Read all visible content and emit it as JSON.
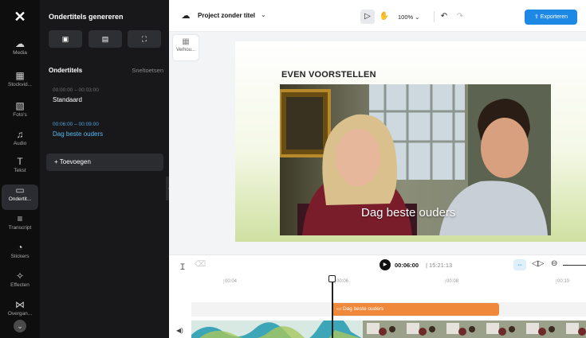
{
  "rail": {
    "items": [
      {
        "name": "media",
        "label": "Media",
        "icon": "media-icon",
        "glyph": "☁"
      },
      {
        "name": "stock",
        "label": "Stockvid...",
        "icon": "stock-video-icon",
        "glyph": "▦"
      },
      {
        "name": "photos",
        "label": "Foto's",
        "icon": "photo-icon",
        "glyph": "▧"
      },
      {
        "name": "audio",
        "label": "Audio",
        "icon": "music-note-icon",
        "glyph": "♫"
      },
      {
        "name": "text",
        "label": "Tekst",
        "icon": "text-icon",
        "glyph": "T"
      },
      {
        "name": "subtitles",
        "label": "Ondertit...",
        "icon": "subtitles-icon",
        "glyph": "▭"
      },
      {
        "name": "transcript",
        "label": "Transcript",
        "icon": "transcript-icon",
        "glyph": "≡"
      },
      {
        "name": "stickers",
        "label": "Stickers",
        "icon": "sticker-icon",
        "glyph": "◔"
      },
      {
        "name": "effects",
        "label": "Effecten",
        "icon": "effects-icon",
        "glyph": "✧"
      },
      {
        "name": "transitions",
        "label": "Overgan...",
        "icon": "transition-icon",
        "glyph": "⋈"
      }
    ],
    "active": "subtitles"
  },
  "panel": {
    "title": "Ondertitels genereren",
    "section_label": "Ondertitels",
    "shortcuts_label": "Sneltoetsen",
    "cues": [
      {
        "time": "00:00:00 – 00:03:00",
        "text": "Standaard",
        "selected": false
      },
      {
        "time": "00:06:00 – 00:09:00",
        "text": "Dag beste ouders",
        "selected": true
      }
    ],
    "add_label": "+ Toevoegen"
  },
  "topbar": {
    "project_title": "Project zonder titel",
    "zoom": "100%",
    "export_label": "⇪ Exporteren"
  },
  "stage": {
    "resize_label": "Verhou...",
    "heading": "EVEN VOORSTELLEN",
    "caption": "Dag beste ouders"
  },
  "timeline": {
    "current_time": "00:06:00",
    "total_time": "| 15:21:13",
    "ticks": [
      "00:04",
      "00:06",
      "00:08",
      "00:10"
    ],
    "subtitle_clip_label": "▭ Dag beste ouders"
  },
  "colors": {
    "accent": "#1e88e5",
    "subtitle_clip": "#f0883b",
    "selected_cue": "#58b9f0"
  }
}
